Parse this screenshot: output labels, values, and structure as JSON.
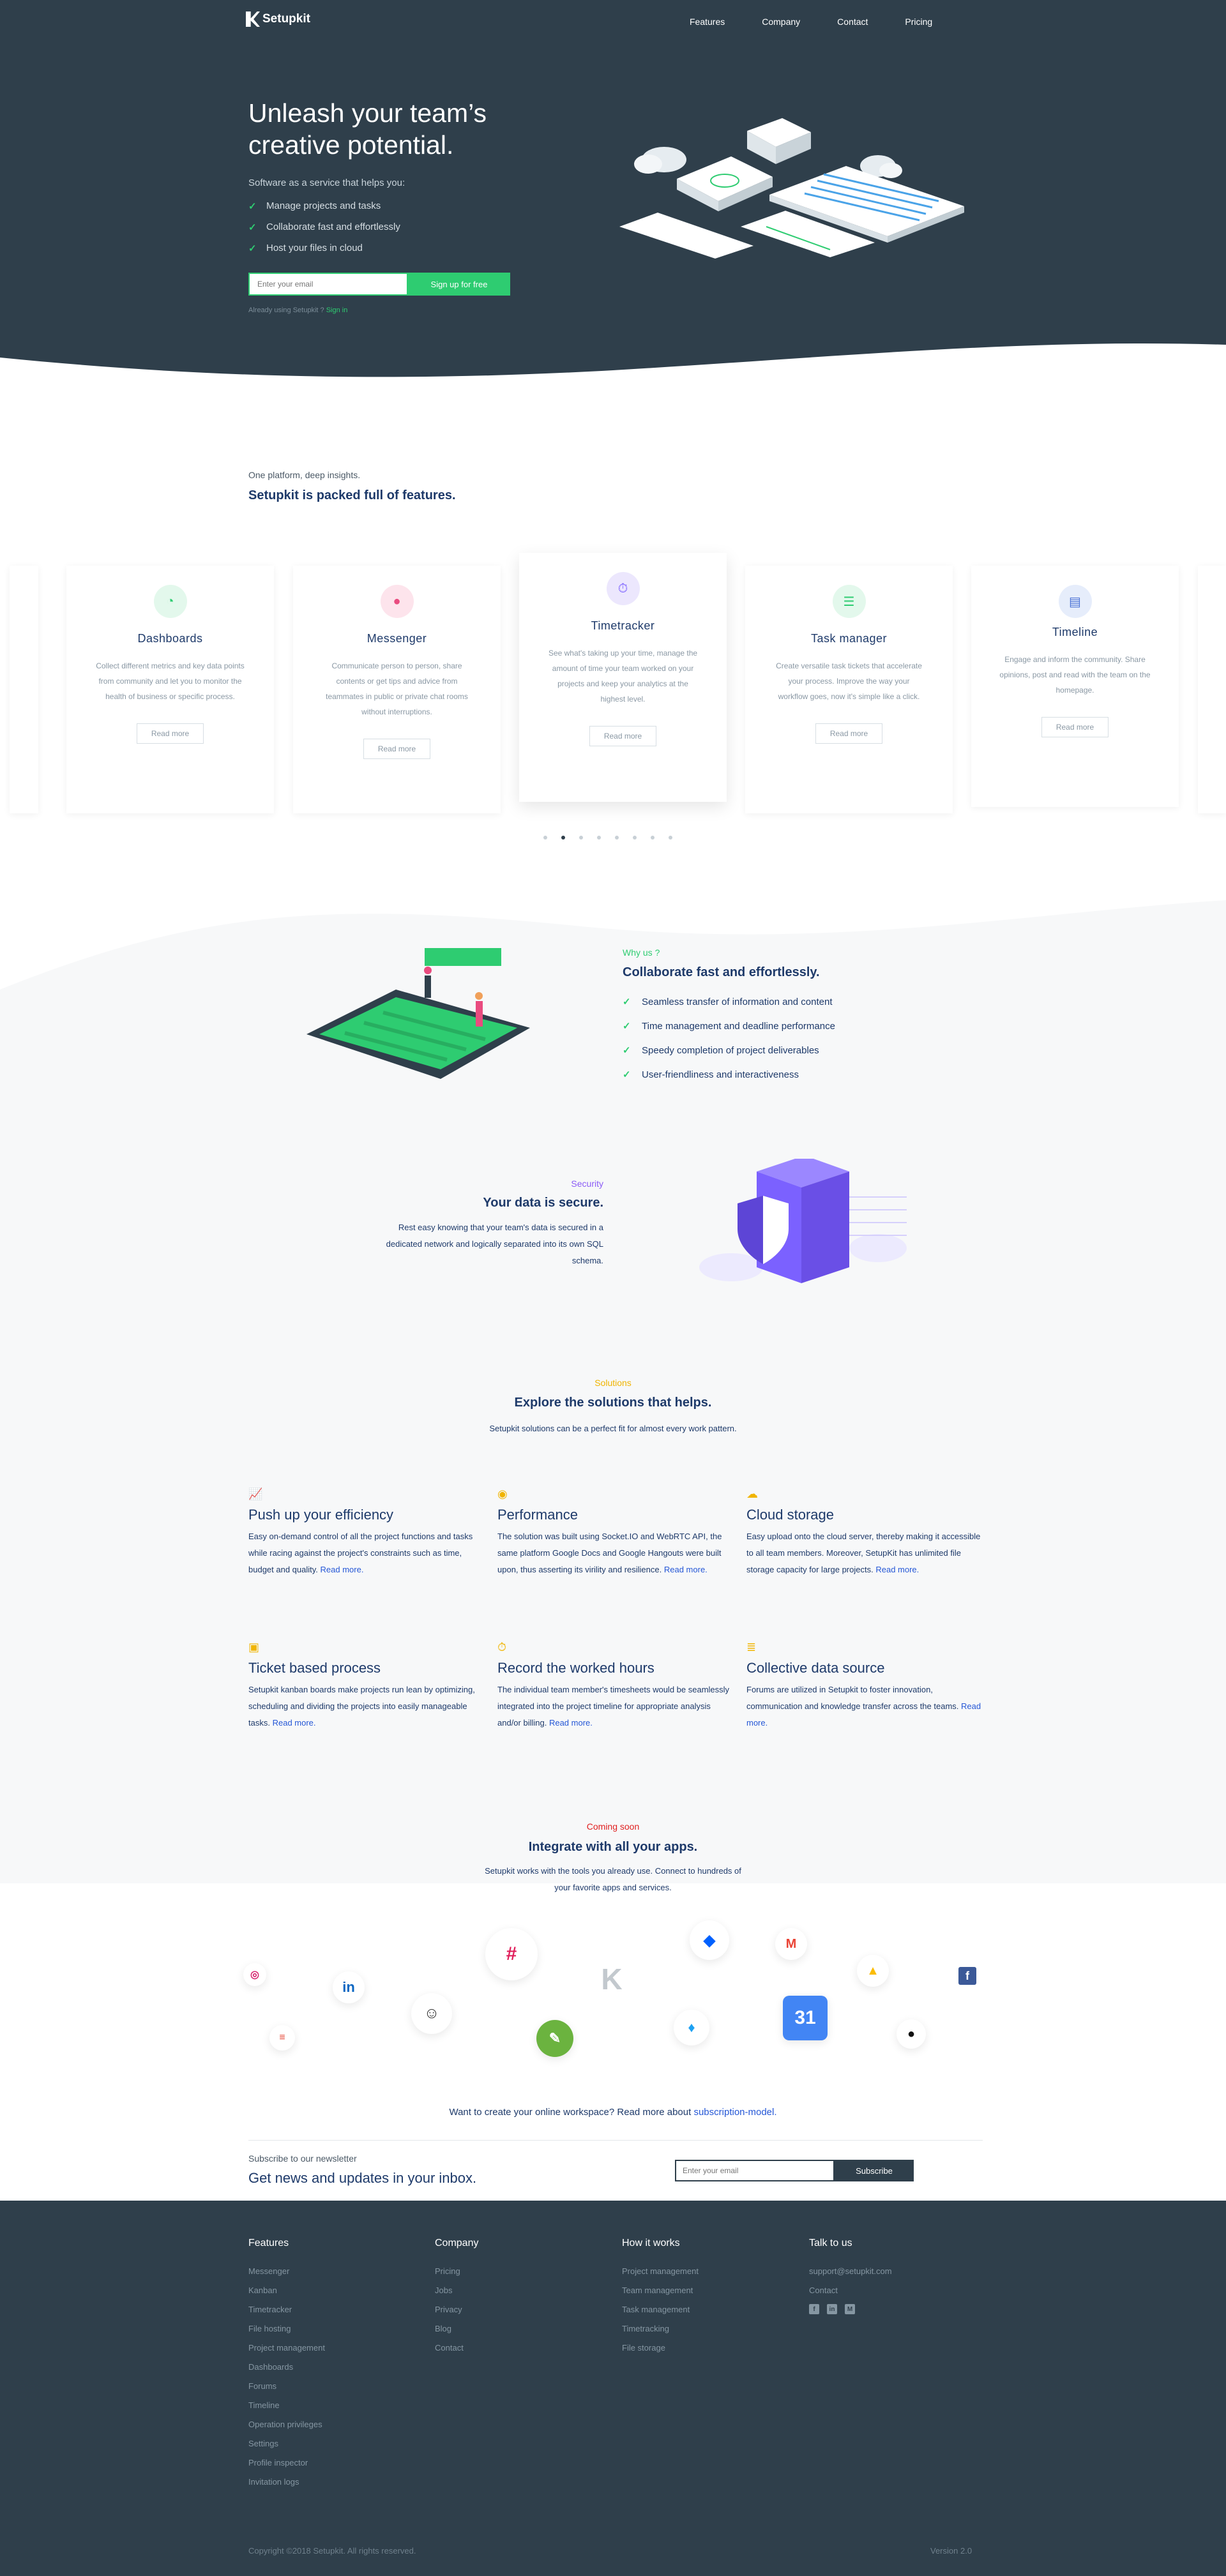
{
  "nav": {
    "brand": "Setupkit",
    "links": [
      "Features",
      "Company",
      "Contact",
      "Pricing"
    ]
  },
  "hero": {
    "title": "Unleash your team’s creative potential.",
    "subtitle": "Software as a service that helps you:",
    "bullets": [
      "Manage projects and tasks",
      "Collaborate fast and effortlessly",
      "Host your files in cloud"
    ],
    "email_placeholder": "Enter your email",
    "signup_label": "Sign up for free",
    "signin_text": "Already using Setupkit ?",
    "signin_link": "Sign in"
  },
  "features": {
    "kicker": "One platform, deep insights.",
    "title": "Setupkit is packed full of features.",
    "cards": [
      {
        "title": "Dashboards",
        "icon": "pie-chart-icon",
        "text": "Collect different metrics and key data points from community and let you to monitor the health of business or specific process.",
        "button": "Read more"
      },
      {
        "title": "Messenger",
        "icon": "chat-bubble-icon",
        "text": "Communicate person to person, share contents or get tips and advice from teammates in public or private chat rooms without interruptions.",
        "button": "Read more"
      },
      {
        "title": "Timetracker",
        "icon": "stopwatch-icon",
        "text": "See what's taking up your time, manage the amount of time your team worked on your projects and keep your analytics at the highest level.",
        "button": "Read more"
      },
      {
        "title": "Task manager",
        "icon": "checklist-icon",
        "text": "Create versatile task tickets that accelerate your process. Improve the way your workflow goes, now it's simple like a click.",
        "button": "Read more"
      },
      {
        "title": "Timeline",
        "icon": "newspaper-icon",
        "text": "Engage and inform the community. Share opinions, post and read with the team on the homepage.",
        "button": "Read more"
      }
    ],
    "active_dot": 1,
    "dot_count": 8
  },
  "why": {
    "kicker": "Why us ?",
    "title": "Collaborate fast and effortlessly.",
    "bullets": [
      "Seamless transfer of information and content",
      "Time management and deadline performance",
      "Speedy completion of project deliverables",
      "User-friendliness and interactiveness"
    ]
  },
  "security": {
    "kicker": "Security",
    "title": "Your data is secure.",
    "text": "Rest easy knowing that your team's data is secured in a dedicated network and logically separated into its own SQL schema."
  },
  "solutions": {
    "kicker": "Solutions",
    "title": "Explore the solutions that helps.",
    "subtitle": "Setupkit solutions can be a perfect fit for almost every work pattern.",
    "items": [
      {
        "icon": "line-chart-icon",
        "title": "Push up your efficiency",
        "text": "Easy on-demand control of all the project functions and tasks while racing against the project's constraints such as time, budget and quality.",
        "link": "Read more."
      },
      {
        "icon": "rss-icon",
        "title": "Performance",
        "text": "The solution was built using Socket.IO and WebRTC API, the same platform Google Docs and Google Hangouts were built upon, thus asserting its virility and resilience.",
        "link": "Read more."
      },
      {
        "icon": "cloud-icon",
        "title": "Cloud storage",
        "text": "Easy upload onto the cloud server, thereby making it accessible to all team members. Moreover, SetupKit has unlimited file storage capacity for large projects.",
        "link": "Read more."
      },
      {
        "icon": "ticket-icon",
        "title": "Ticket based process",
        "text": "Setupkit kanban boards make projects run lean by optimizing, scheduling and dividing the projects into easily manageable tasks.",
        "link": "Read more."
      },
      {
        "icon": "stopwatch-icon",
        "title": "Record the worked hours",
        "text": "The individual team member's timesheets would be seamlessly integrated into the project timeline for appropriate analysis and/or billing.",
        "link": "Read more."
      },
      {
        "icon": "database-icon",
        "title": "Collective data source",
        "text": "Forums are utilized in Setupkit to foster innovation, communication and knowledge transfer across the teams.",
        "link": "Read more."
      }
    ]
  },
  "integrations": {
    "kicker": "Coming soon",
    "title": "Integrate with all your apps.",
    "subtitle": "Setupkit works with the tools you already use. Connect to hundreds of your favorite apps and services.",
    "apps": [
      "instagram-icon",
      "linkedin-icon",
      "todoist-icon",
      "mailchimp-icon",
      "slack-icon",
      "evernote-icon",
      "setupkit-icon",
      "dropbox-icon",
      "twitter-icon",
      "gmail-icon",
      "google-calendar-icon",
      "google-drive-icon",
      "github-icon",
      "facebook-icon"
    ],
    "calendar_day": "31",
    "cta_text": "Want to create your online workspace? Read more about",
    "cta_link": "subscription-model."
  },
  "newsletter": {
    "kicker": "Subscribe to our newsletter",
    "title": "Get news and updates in your inbox.",
    "placeholder": "Enter your email",
    "button": "Subscribe"
  },
  "footer": {
    "columns": [
      {
        "title": "Features",
        "items": [
          "Messenger",
          "Kanban",
          "Timetracker",
          "File hosting",
          "Project management",
          "Dashboards",
          "Forums",
          "Timeline",
          "Operation privileges",
          "Settings",
          "Profile inspector",
          "Invitation logs"
        ]
      },
      {
        "title": "Company",
        "items": [
          "Pricing",
          "Jobs",
          "Privacy",
          "Blog",
          "Contact"
        ]
      },
      {
        "title": "How it works",
        "items": [
          "Project management",
          "Team management",
          "Task management",
          "Timetracking",
          "File storage"
        ]
      },
      {
        "title": "Talk to us",
        "items": [
          "support@setupkit.com",
          "Contact"
        ]
      }
    ],
    "social": [
      "facebook-icon",
      "linkedin-icon",
      "medium-icon"
    ],
    "copyright": "Copyright ©2018 Setupkit. All rights reserved.",
    "version": "Version 2.0"
  },
  "colors": {
    "dark": "#2f3f4b",
    "green": "#2ecc71",
    "navy": "#1e3a6a",
    "purple": "#7b61ff",
    "yellow": "#f0b400",
    "link": "#2557d6"
  }
}
